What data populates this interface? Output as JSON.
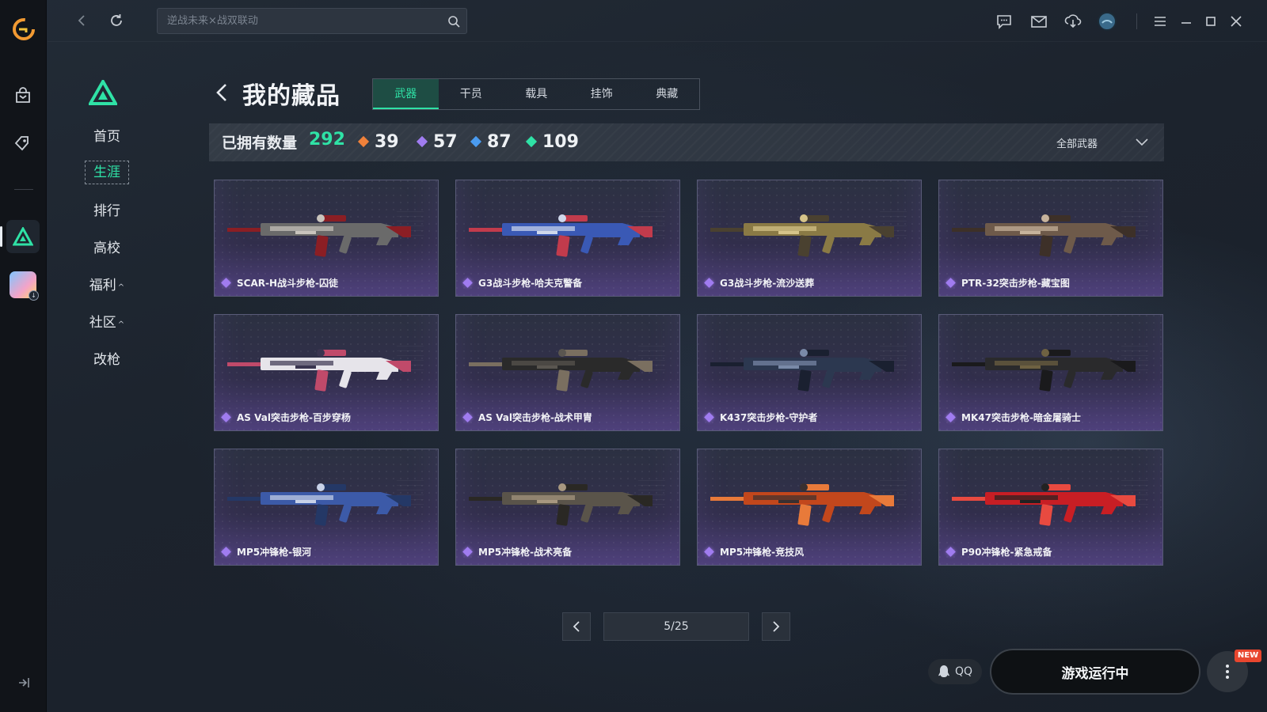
{
  "colors": {
    "accent": "#2fe2a6",
    "rarity_orange": "#f0813a",
    "rarity_purple": "#a07cf0",
    "rarity_blue": "#4a9bf0",
    "rarity_green": "#2fe2a6",
    "new_badge": "#e8462e"
  },
  "sidebar": {
    "icons": [
      "app-logo-icon",
      "store-bag-icon",
      "tag-icon",
      "game-triangle-icon",
      "game-avatar-icon",
      "collapse-sidebar-icon"
    ]
  },
  "topbar": {
    "search_placeholder": "逆战未来×战双联动",
    "icons": [
      "back-icon",
      "refresh-icon",
      "search-icon",
      "chat-icon",
      "mail-icon",
      "download-icon",
      "avatar",
      "menu-icon",
      "minimize-icon",
      "maximize-icon",
      "close-icon"
    ]
  },
  "game_menu": {
    "items": [
      {
        "label": "首页"
      },
      {
        "label": "生涯",
        "active": true
      },
      {
        "label": "排行"
      },
      {
        "label": "高校"
      },
      {
        "label": "福利",
        "caret": "^"
      },
      {
        "label": "社区",
        "caret": "^"
      },
      {
        "label": "改枪"
      }
    ]
  },
  "main": {
    "title": "我的藏品",
    "tabs": [
      {
        "label": "武器",
        "active": true
      },
      {
        "label": "干员"
      },
      {
        "label": "载具"
      },
      {
        "label": "挂饰"
      },
      {
        "label": "典藏"
      }
    ],
    "stats": {
      "owned_label": "已拥有数量",
      "owned_total": "292",
      "rarities": [
        {
          "color": "#f0813a",
          "count": "39"
        },
        {
          "color": "#a07cf0",
          "count": "57"
        },
        {
          "color": "#4a9bf0",
          "count": "87"
        },
        {
          "color": "#2fe2a6",
          "count": "109"
        }
      ],
      "filter_label": "全部武器"
    },
    "items": [
      {
        "name": "SCAR-H战斗步枪-囚徒",
        "palette": [
          "#6a6a6a",
          "#c9c4bd",
          "#8b1e24"
        ]
      },
      {
        "name": "G3战斗步枪-哈夫克警备",
        "palette": [
          "#3a59b5",
          "#cfd8ec",
          "#c23b4c"
        ]
      },
      {
        "name": "G3战斗步枪-流沙送葬",
        "palette": [
          "#8a7a45",
          "#d6c48a",
          "#4a4130"
        ]
      },
      {
        "name": "PTR-32突击步枪-藏宝图",
        "palette": [
          "#6e5a4a",
          "#c7b39c",
          "#3d3028"
        ]
      },
      {
        "name": "AS Val突击步枪-百步穿杨",
        "palette": [
          "#e6e4ea",
          "#3a3550",
          "#c04a6a"
        ]
      },
      {
        "name": "AS Val突击步枪-战术甲胄",
        "palette": [
          "#2a2a2a",
          "#5a5650",
          "#7a6f60"
        ]
      },
      {
        "name": "K437突击步枪-守护者",
        "palette": [
          "#2c3850",
          "#7a8aa8",
          "#1a2030"
        ]
      },
      {
        "name": "MK47突击步枪-暗金屠骑士",
        "palette": [
          "#2a2a2c",
          "#6f6242",
          "#1a1a1c"
        ]
      },
      {
        "name": "MP5冲锋枪-银河",
        "palette": [
          "#3c5aa8",
          "#c8d2e8",
          "#243866"
        ]
      },
      {
        "name": "MP5冲锋枪-战术亮备",
        "palette": [
          "#5a544a",
          "#a89880",
          "#2a2824"
        ]
      },
      {
        "name": "MP5冲锋枪-竞技风",
        "palette": [
          "#c2471c",
          "#3a3030",
          "#e87a3a"
        ]
      },
      {
        "name": "P90冲锋枪-紧急戒备",
        "palette": [
          "#c81e24",
          "#222222",
          "#e84a40"
        ]
      }
    ],
    "pager": {
      "text": "5/25"
    }
  },
  "footer": {
    "qq_label": "QQ",
    "launch_label": "游戏运行中",
    "new_badge": "NEW"
  }
}
